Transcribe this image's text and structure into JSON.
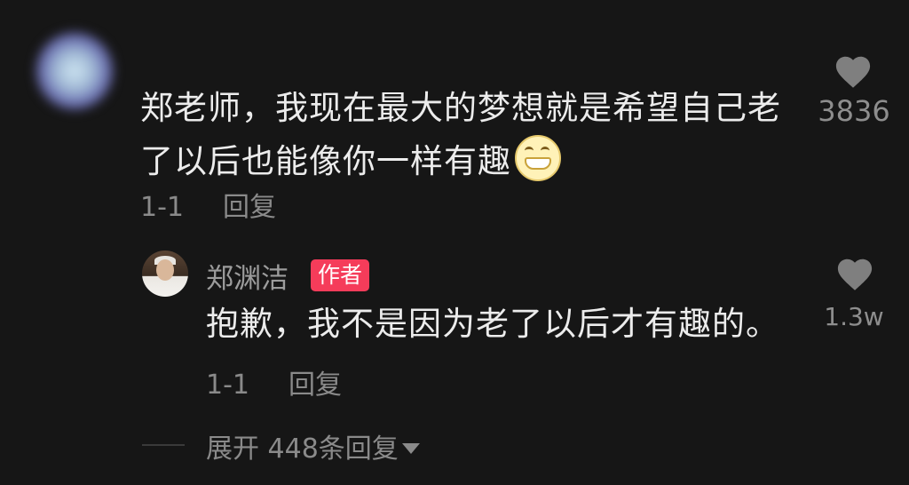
{
  "comment": {
    "text": "郑老师，我现在最大的梦想就是希望自己老了以后也能像你一样有趣",
    "emoji": "grinning-face-emoji",
    "likes": "3836",
    "time": "1-1",
    "reply_label": "回复"
  },
  "reply": {
    "author": "郑渊洁",
    "badge": "作者",
    "text": "抱歉，我不是因为老了以后才有趣的。",
    "likes": "1.3w",
    "time": "1-1",
    "reply_label": "回复"
  },
  "expand": {
    "label": "展开 448条回复"
  },
  "colors": {
    "background": "#161616",
    "badge": "#f53c5a",
    "secondary_text": "#8a8a8a",
    "heart": "#7f7f7f"
  }
}
